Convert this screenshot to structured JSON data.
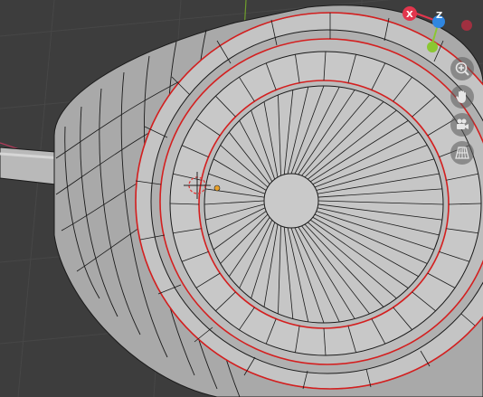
{
  "viewport": {
    "background": "#3d3d3d",
    "grid_line_color": "#474747",
    "axis_y_color": "#6f9e2c",
    "mesh_fill": "#bdbdbd",
    "mesh_edge": "#1a1a1a",
    "selected_edge": "#d41f1f",
    "origin_dot": "#e8a12c"
  },
  "gizmo": {
    "x_label": "X",
    "z_label": "Z",
    "x_color": "#e2364d",
    "y_color": "#8bc732",
    "z_color": "#2f86e0",
    "neg_x_color": "#a03040"
  },
  "navigation": [
    {
      "name": "zoom",
      "icon": "zoom-icon"
    },
    {
      "name": "pan",
      "icon": "hand-icon"
    },
    {
      "name": "camera",
      "icon": "camera-icon"
    },
    {
      "name": "perspective",
      "icon": "grid-perspective-icon"
    }
  ]
}
